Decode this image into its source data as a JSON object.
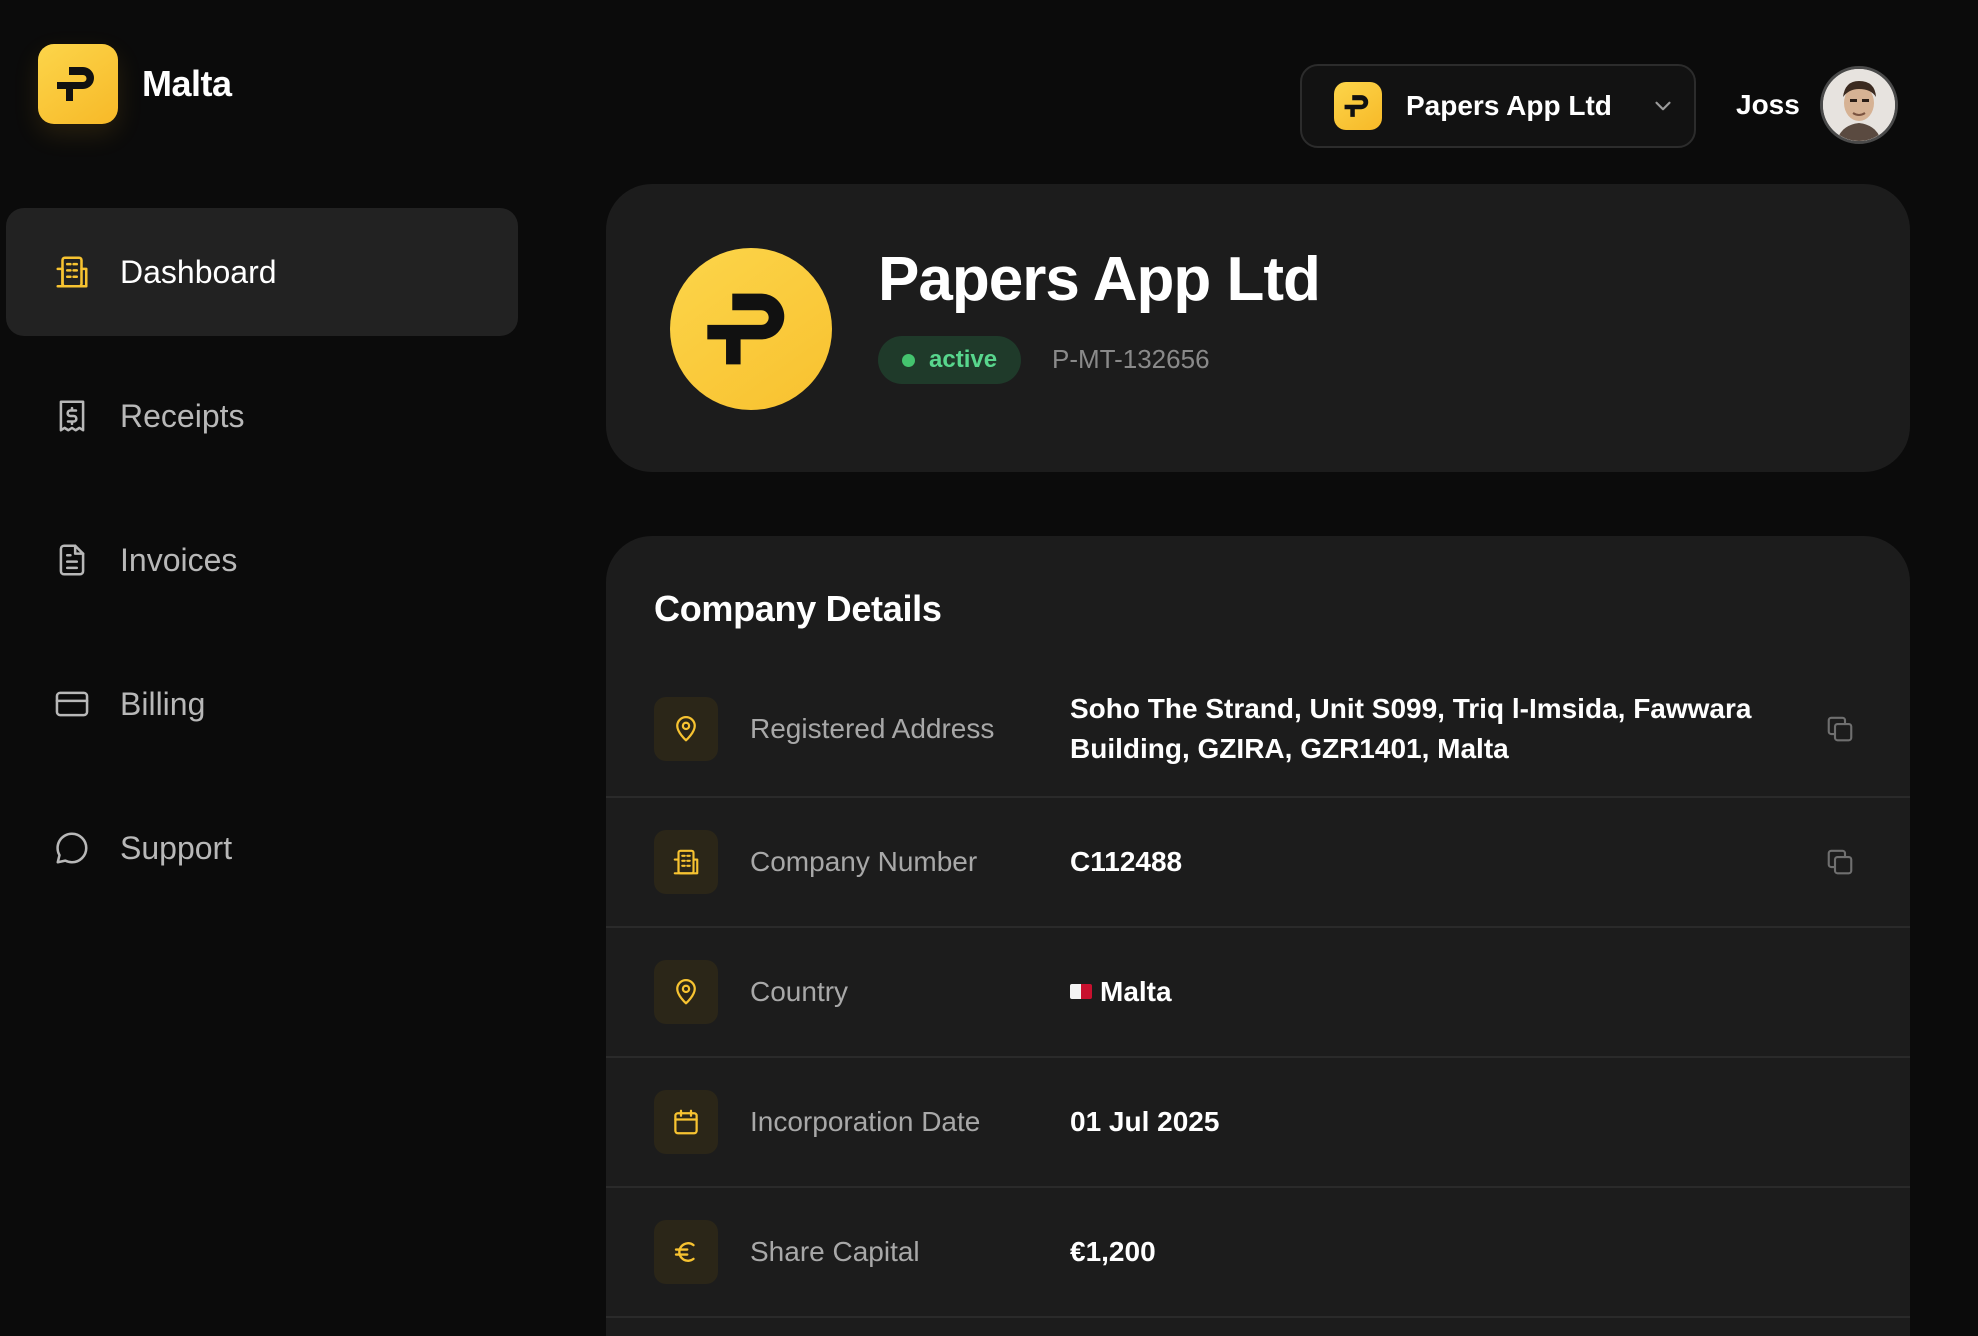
{
  "brand": {
    "name": "Malta",
    "logo_icon": "papers-logo-icon"
  },
  "sidebar": {
    "items": [
      {
        "label": "Dashboard",
        "icon": "building-icon",
        "active": true
      },
      {
        "label": "Receipts",
        "icon": "receipt-icon",
        "active": false
      },
      {
        "label": "Invoices",
        "icon": "document-icon",
        "active": false
      },
      {
        "label": "Billing",
        "icon": "credit-card-icon",
        "active": false
      },
      {
        "label": "Support",
        "icon": "chat-bubble-icon",
        "active": false
      }
    ]
  },
  "header": {
    "company_switcher": {
      "name": "Papers App Ltd",
      "icon": "chevron-down-icon"
    },
    "user": {
      "name": "Joss"
    }
  },
  "profile": {
    "company_name": "Papers App Ltd",
    "status": "active",
    "reference": "P-MT-132656"
  },
  "details": {
    "title": "Company Details",
    "rows": [
      {
        "label": "Registered Address",
        "value": "Soho The Strand, Unit S099, Triq l-Imsida, Fawwara Building, GZIRA, GZR1401, Malta",
        "icon": "map-pin-icon",
        "copyable": true
      },
      {
        "label": "Company Number",
        "value": "C112488",
        "icon": "building-icon",
        "copyable": true
      },
      {
        "label": "Country",
        "value": "Malta",
        "icon": "map-pin-icon",
        "copyable": false
      },
      {
        "label": "Incorporation Date",
        "value": "01 Jul 2025",
        "icon": "calendar-icon",
        "copyable": false
      },
      {
        "label": "Share Capital",
        "value": "€1,200",
        "icon": "euro-icon",
        "copyable": false
      }
    ]
  },
  "colors": {
    "accent": "#f7c331",
    "background": "#0b0b0b",
    "card": "#1c1c1c",
    "status_active": "#58d68d"
  }
}
